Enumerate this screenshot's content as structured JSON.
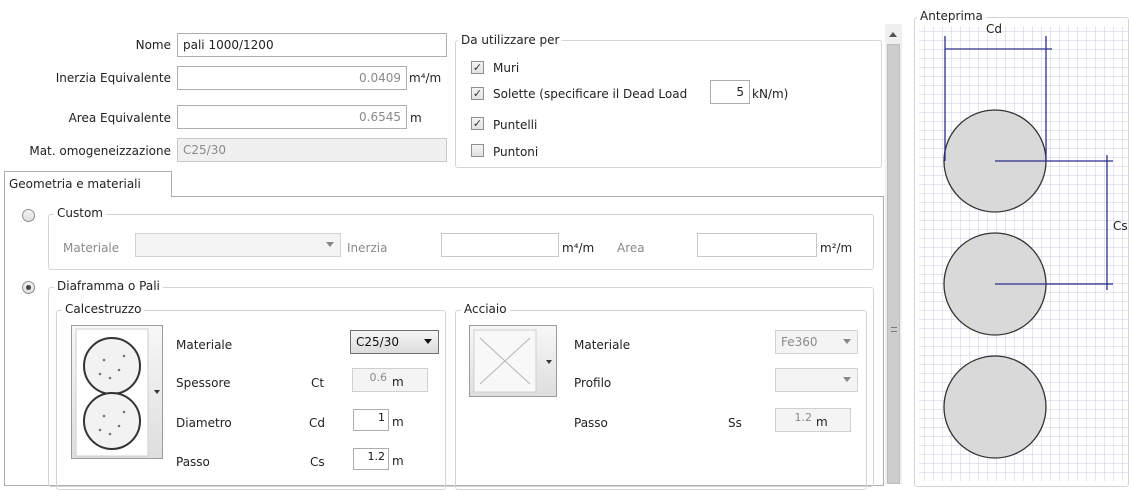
{
  "header": {
    "nome_label": "Nome",
    "nome_value": "pali 1000/1200",
    "inerzia_label": "Inerzia Equivalente",
    "inerzia_value": "0.0409",
    "inerzia_unit": "m⁴/m",
    "area_label": "Area Equivalente",
    "area_value": "0.6545",
    "area_unit": "m",
    "mat_label": "Mat. omogeneizzazione",
    "mat_value": "C25/30"
  },
  "usage": {
    "legend": "Da utilizzare per",
    "items": [
      {
        "label": "Muri",
        "checked": true
      },
      {
        "label": "Solette  (specificare il Dead Load",
        "checked": true
      },
      {
        "label": "Puntelli",
        "checked": true
      },
      {
        "label": "Puntoni",
        "checked": false
      }
    ],
    "dead_load_value": "5",
    "dead_load_unit": "kN/m)"
  },
  "tabs": [
    {
      "label": "Geometria e materiali",
      "active": true
    }
  ],
  "custom": {
    "legend": "Custom",
    "selected": false,
    "materiale_label": "Materiale",
    "materiale_value": "",
    "inerzia_label": "Inerzia",
    "inerzia_value": "",
    "inerzia_unit": "m⁴/m",
    "area_label": "Area",
    "area_value": "",
    "area_unit": "m²/m"
  },
  "diaframma": {
    "legend": "Diaframma o Pali",
    "selected": true,
    "calcestruzzo": {
      "legend": "Calcestruzzo",
      "materiale_label": "Materiale",
      "materiale_value": "C25/30",
      "spessore_label": "Spessore",
      "spessore_symbol": "Ct",
      "spessore_value": "0.6",
      "spessore_unit": "m",
      "diametro_label": "Diametro",
      "diametro_symbol": "Cd",
      "diametro_value": "1",
      "diametro_unit": "m",
      "passo_label": "Passo",
      "passo_symbol": "Cs",
      "passo_value": "1.2",
      "passo_unit": "m"
    },
    "acciaio": {
      "legend": "Acciaio",
      "materiale_label": "Materiale",
      "materiale_value": "Fe360",
      "profilo_label": "Profilo",
      "profilo_value": "",
      "passo_label": "Passo",
      "passo_symbol": "Ss",
      "passo_value": "1.2",
      "passo_unit": "m"
    }
  },
  "preview": {
    "legend": "Anteprima",
    "cd_label": "Cd",
    "cs_label": "Cs"
  },
  "colors": {
    "dimension_line": "#2b2f8c",
    "pile_fill": "#d9d9d9",
    "grid": "#c9cbe0"
  }
}
